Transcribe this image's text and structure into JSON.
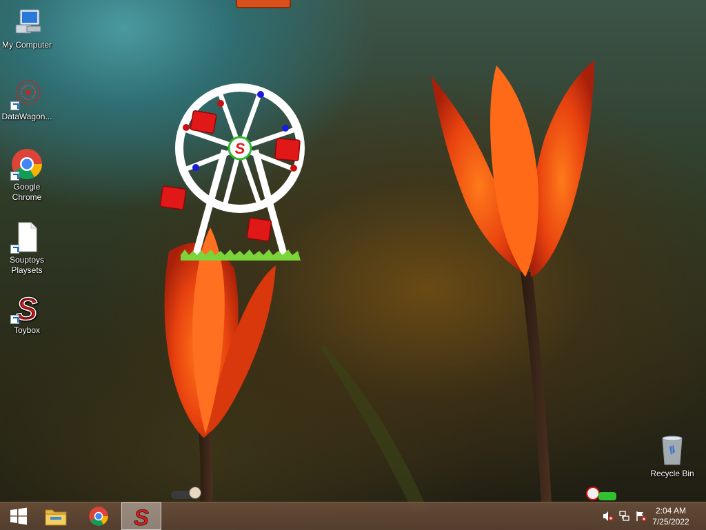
{
  "desktop": {
    "icons": [
      {
        "label": "My Computer",
        "icon": "computer-icon"
      },
      {
        "label": "DataWagon...",
        "icon": "datawagon-icon"
      },
      {
        "label": "Google Chrome",
        "icon": "chrome-icon"
      },
      {
        "label": "Souptoys Playsets",
        "icon": "document-icon"
      },
      {
        "label": "Toybox",
        "icon": "souptoys-s-icon"
      },
      {
        "label": "Recycle Bin",
        "icon": "recycle-bin-icon"
      }
    ]
  },
  "taskbar": {
    "pinned": [
      "start-icon",
      "file-explorer-icon",
      "chrome-icon",
      "souptoys-icon"
    ],
    "clock": {
      "time": "2:04 AM",
      "date": "7/25/2022"
    },
    "tray": [
      "volume-muted-icon",
      "network-icon",
      "action-center-flag-icon"
    ]
  },
  "toy": {
    "wheel_logo": "S"
  },
  "colors": {
    "accent_red": "#e01818",
    "taskbar": "#6a4e3a"
  }
}
